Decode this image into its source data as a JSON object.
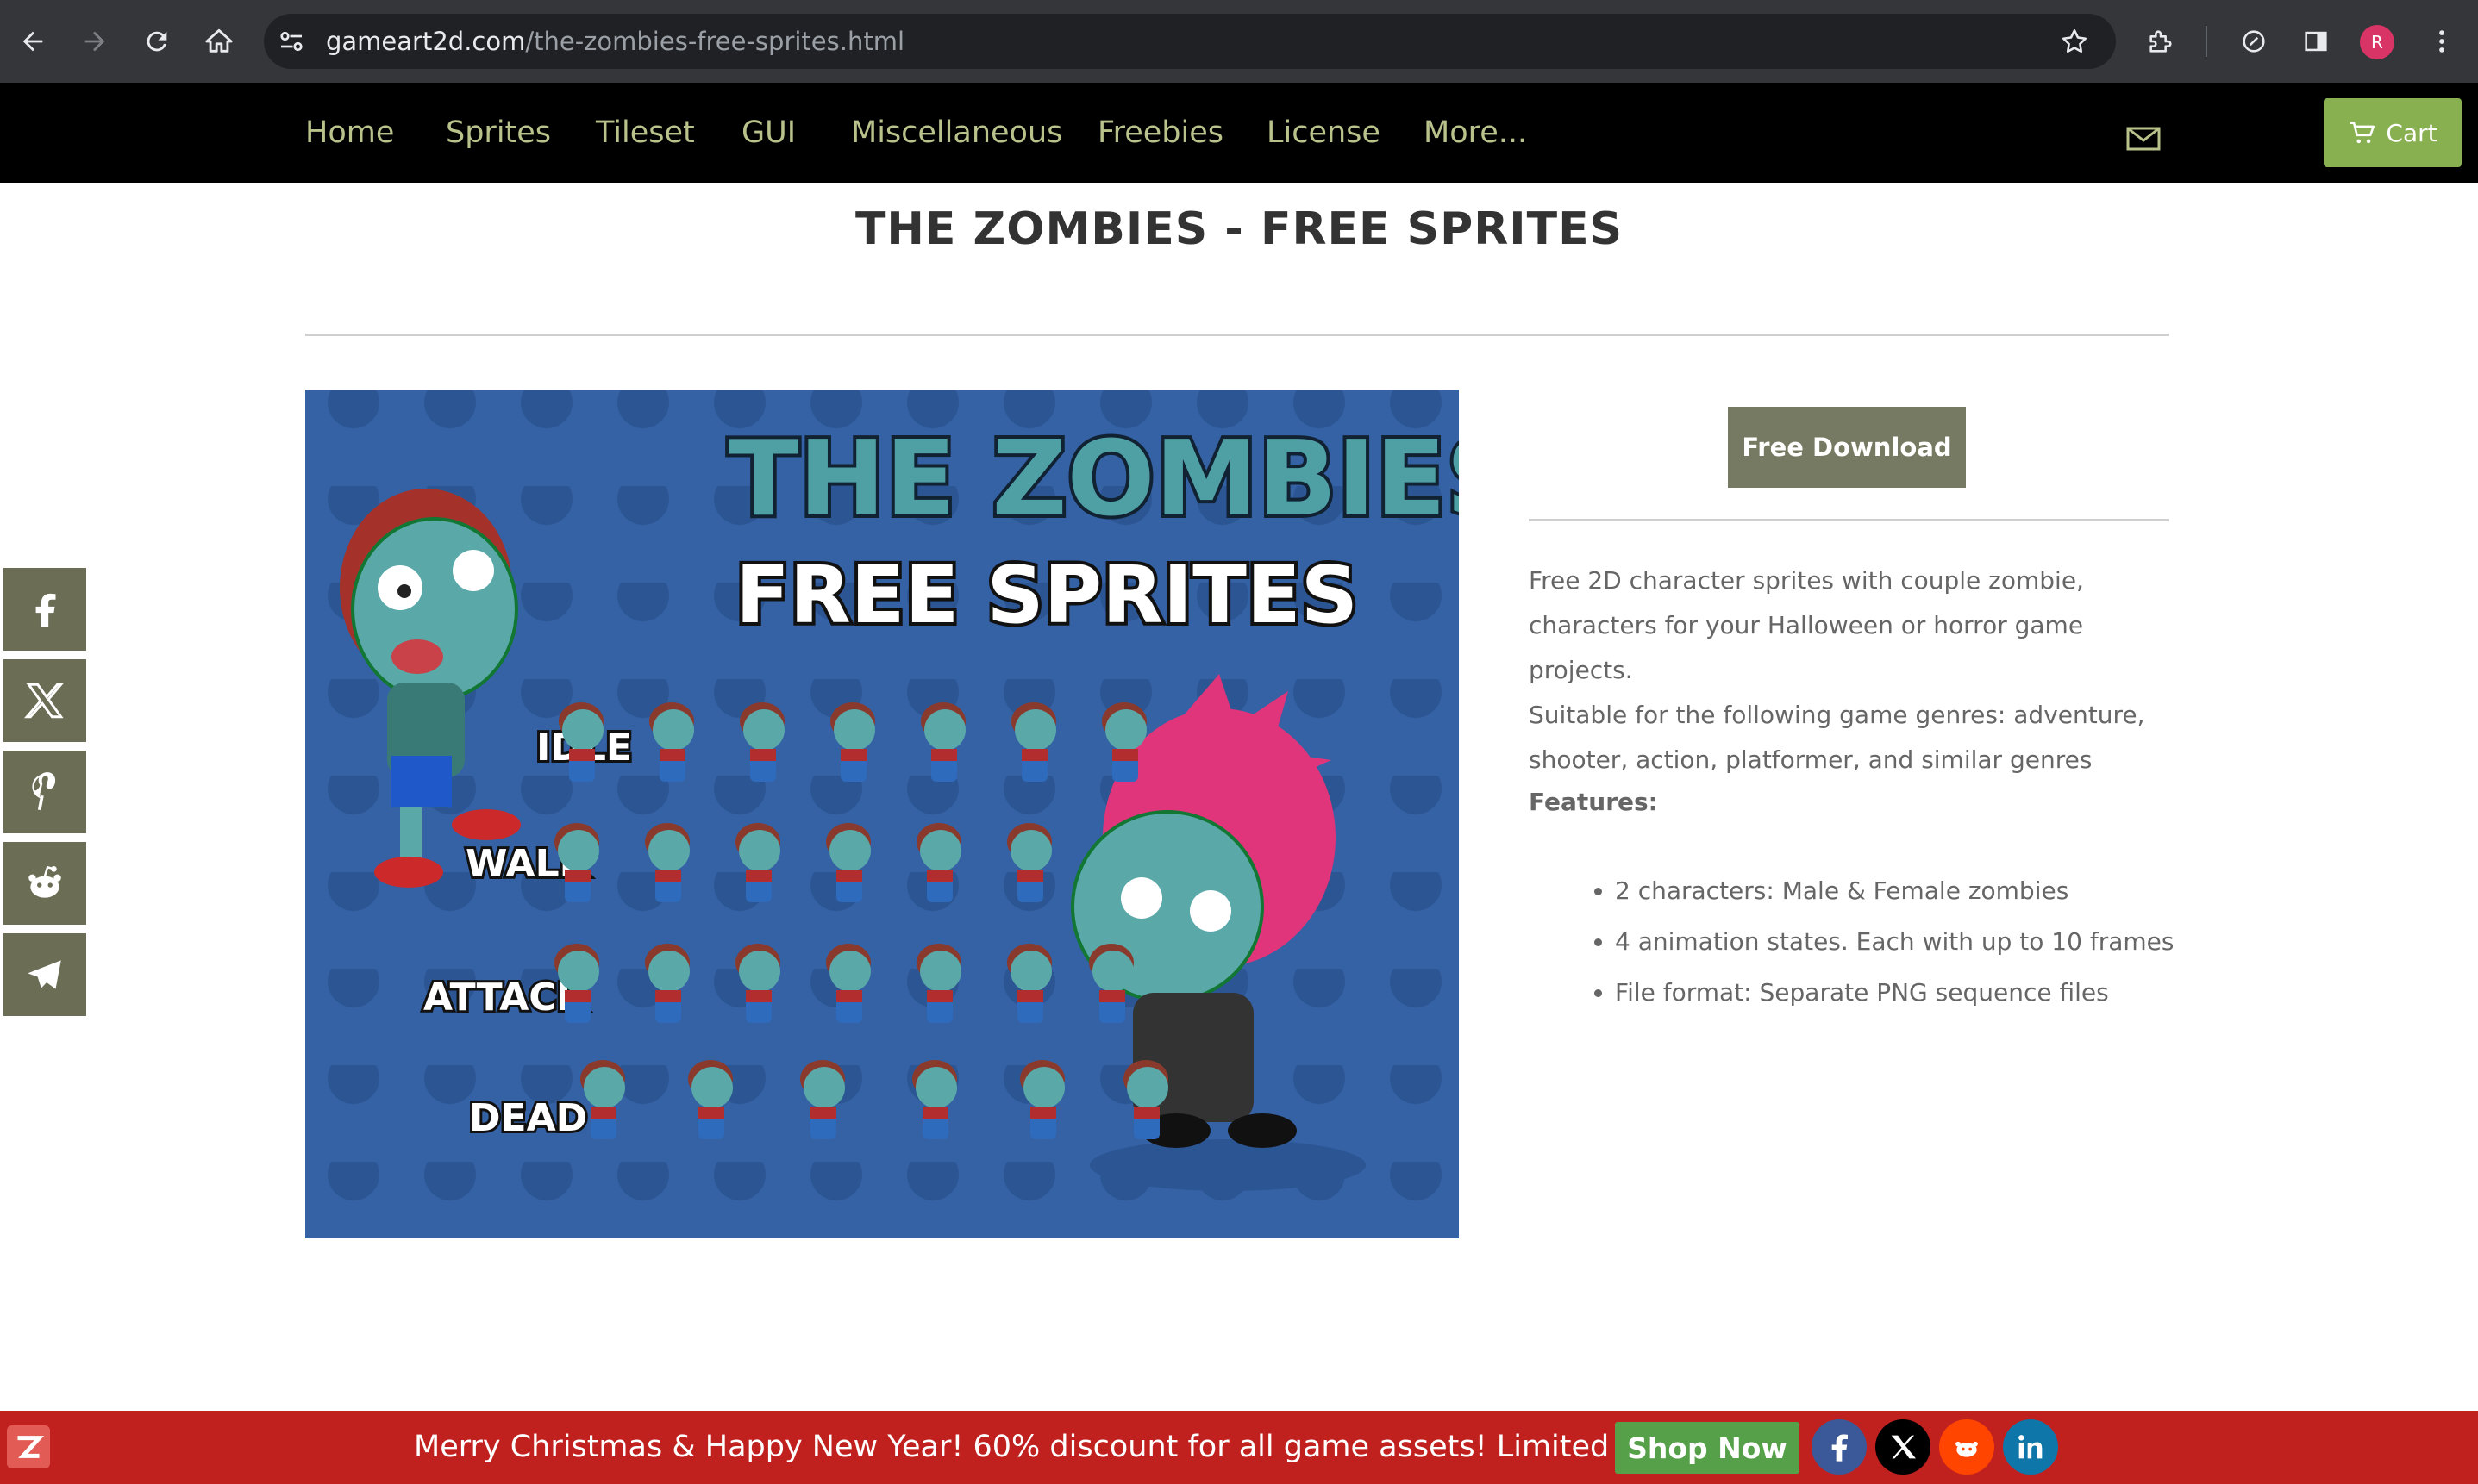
{
  "browser": {
    "url_host": "gameart2d.com",
    "url_path": "/the-zombies-free-sprites.html",
    "profile_initial": "R"
  },
  "nav": {
    "items": [
      "Home",
      "Sprites",
      "Tileset",
      "GUI",
      "Miscellaneous",
      "Freebies",
      "License",
      "More..."
    ],
    "cart_label": "Cart"
  },
  "page": {
    "title": "THE ZOMBIES - FREE SPRITES",
    "download_label": "Free Download",
    "description": [
      "Free 2D character sprites with couple zombie, characters for your Halloween or horror game projects.",
      "Suitable for the following game genres: adventure, shooter, action, platformer, and similar genres"
    ],
    "features_label": "Features:",
    "features": [
      "2 characters: Male & Female zombies",
      "4 animation states. Each with up to 10 frames",
      "File format: Separate PNG sequence files"
    ]
  },
  "hero": {
    "headline": "THE ZOMBIES",
    "subline": "FREE SPRITES",
    "rows": [
      "IDLE",
      "WALK",
      "ATTACK",
      "DEAD"
    ]
  },
  "social_sidebar": [
    "facebook-icon",
    "x-icon",
    "pinterest-icon",
    "reddit-icon",
    "telegram-icon"
  ],
  "banner": {
    "text": "Merry Christmas & Happy New Year! 60% discount for all game assets! Limited time offer!",
    "button": "Shop Now",
    "social": [
      "facebook-icon",
      "x-icon",
      "reddit-icon",
      "linkedin-icon"
    ]
  },
  "colors": {
    "nav_bg": "#000000",
    "nav_text": "#b9c28a",
    "cart_green": "#88b050",
    "download_bg": "#777a63",
    "sidebar_bg": "#6b6d55",
    "banner_red": "#c0211f",
    "shop_green": "#55a048",
    "hero_blue": "#3561a5"
  }
}
